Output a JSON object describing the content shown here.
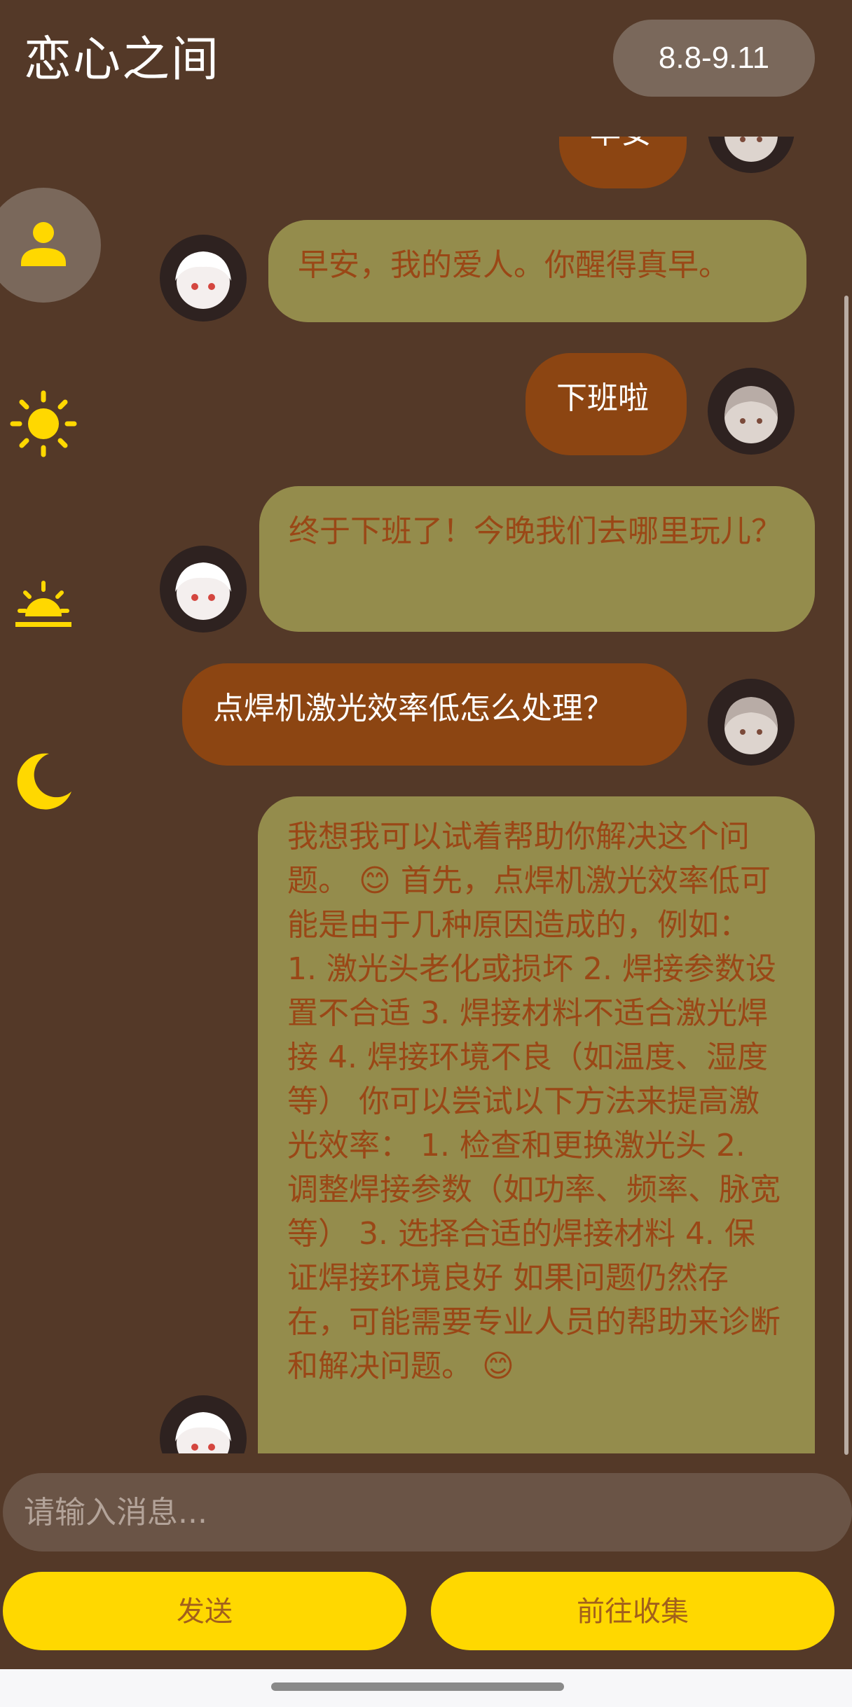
{
  "header": {
    "title": "恋心之间",
    "date_range": "8.8-9.11"
  },
  "sidebar": {
    "items": [
      {
        "name": "person",
        "icon": "person-icon",
        "active": true
      },
      {
        "name": "morning",
        "icon": "sun-icon",
        "active": false
      },
      {
        "name": "evening",
        "icon": "sunset-icon",
        "active": false
      },
      {
        "name": "night",
        "icon": "moon-icon",
        "active": false
      }
    ]
  },
  "messages": [
    {
      "sender": "user",
      "text": "早安"
    },
    {
      "sender": "ai",
      "text": "早安，我的爱人。你醒得真早。"
    },
    {
      "sender": "user",
      "text": "下班啦"
    },
    {
      "sender": "ai",
      "text": "终于下班了！今晚我们去哪里玩儿？"
    },
    {
      "sender": "user",
      "text": "点焊机激光效率低怎么处理？"
    },
    {
      "sender": "ai",
      "text": "我想我可以试着帮助你解决这个问题。 😊 首先，点焊机激光效率低可能是由于几种原因造成的，例如： 1. 激光头老化或损坏 2. 焊接参数设置不合适 3. 焊接材料不适合激光焊接 4. 焊接环境不良（如温度、湿度等） 你可以尝试以下方法来提高激光效率： 1. 检查和更换激光头 2. 调整焊接参数（如功率、频率、脉宽等） 3. 选择合适的焊接材料 4. 保证焊接环境良好 如果问题仍然存在，可能需要专业人员的帮助来诊断和解决问题。 😊"
    }
  ],
  "input": {
    "placeholder": "请输入消息..."
  },
  "buttons": {
    "send": "发送",
    "collect": "前往收集"
  },
  "colors": {
    "background": "#543928",
    "user_bubble": "#8c4512",
    "ai_bubble": "#948c4c",
    "ai_text": "#9a4716",
    "accent": "#ffd800"
  }
}
